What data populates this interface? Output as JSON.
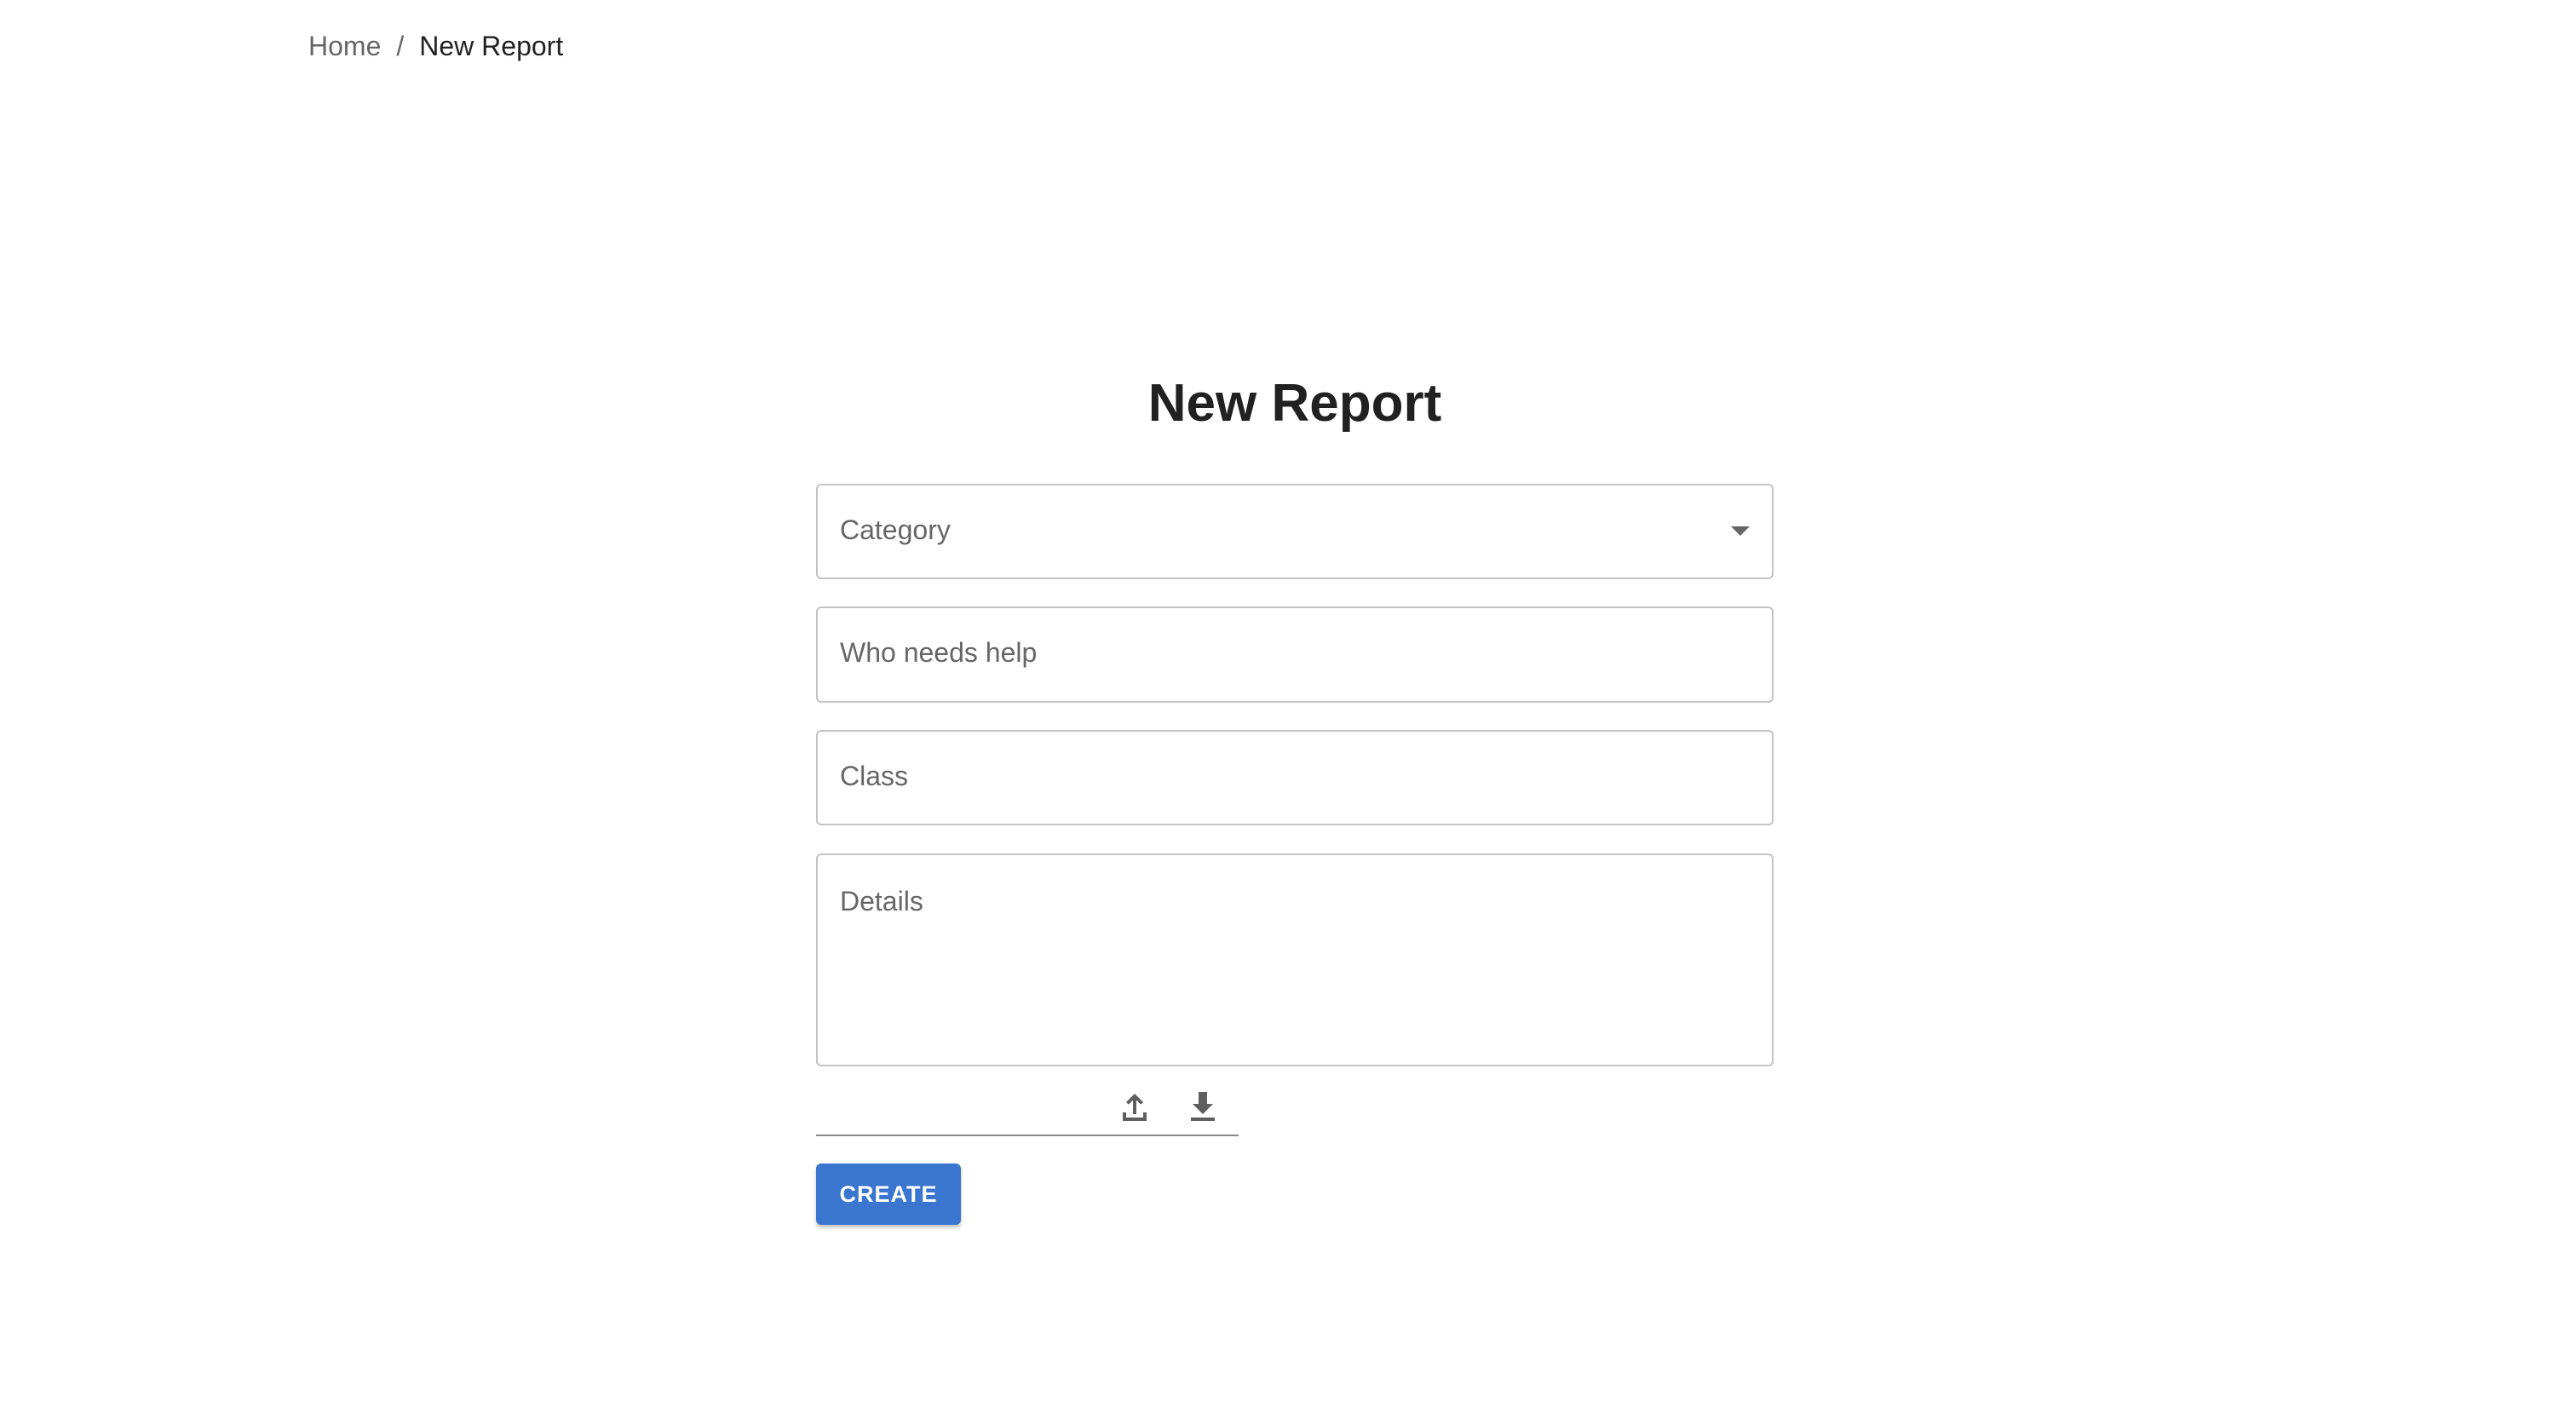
{
  "breadcrumb": {
    "home": "Home",
    "separator": "/",
    "current": "New Report"
  },
  "page": {
    "title": "New Report"
  },
  "form": {
    "category": {
      "label": "Category",
      "value": "",
      "icon": "caret-down-icon"
    },
    "who_needs_help": {
      "label": "Who needs help",
      "value": ""
    },
    "class": {
      "label": "Class",
      "value": ""
    },
    "details": {
      "label": "Details",
      "value": ""
    },
    "file_actions": {
      "upload_icon": "upload-icon",
      "download_icon": "download-icon"
    },
    "create_label": "CREATE"
  },
  "colors": {
    "primary": "#3a76d0",
    "text": "#212121",
    "muted": "#666666",
    "border": "#c4c4c4"
  }
}
